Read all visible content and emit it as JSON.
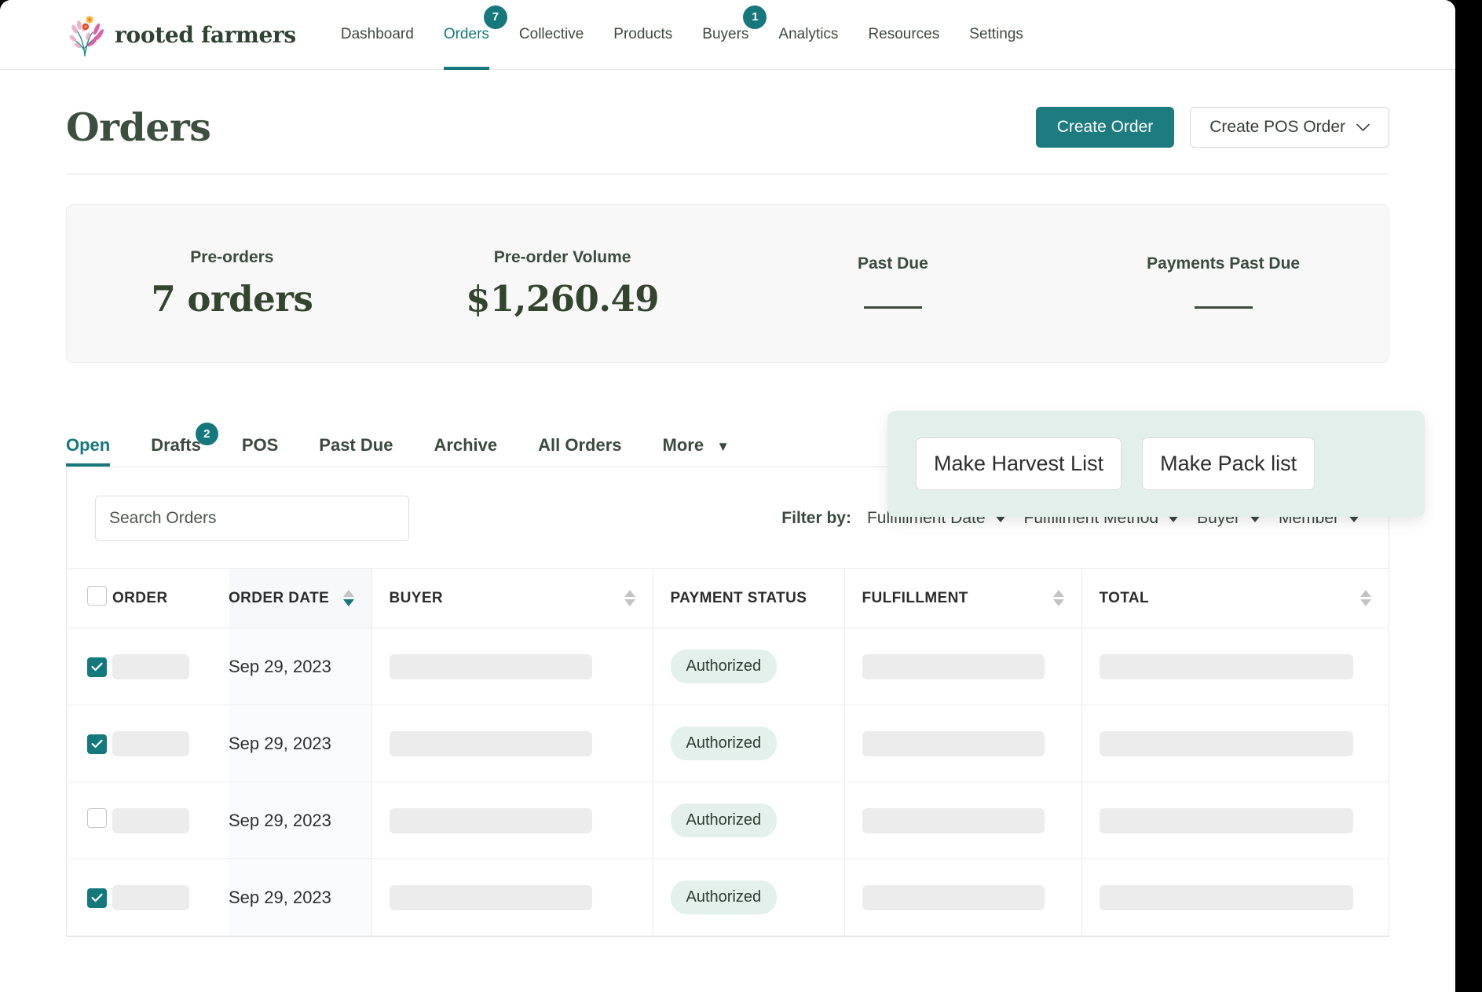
{
  "brand": {
    "name": "rooted farmers",
    "logo_icon": "floral-bouquet-icon"
  },
  "nav": {
    "items": [
      {
        "label": "Dashboard",
        "badge": null,
        "active": false
      },
      {
        "label": "Orders",
        "badge": "7",
        "active": true
      },
      {
        "label": "Collective",
        "badge": null,
        "active": false
      },
      {
        "label": "Products",
        "badge": null,
        "active": false
      },
      {
        "label": "Buyers",
        "badge": "1",
        "active": false
      },
      {
        "label": "Analytics",
        "badge": null,
        "active": false
      },
      {
        "label": "Resources",
        "badge": null,
        "active": false
      },
      {
        "label": "Settings",
        "badge": null,
        "active": false
      }
    ]
  },
  "page": {
    "title": "Orders",
    "create_order_label": "Create Order",
    "create_pos_order_label": "Create POS Order",
    "chevron_icon": "chevron-down-icon"
  },
  "stats": [
    {
      "label": "Pre-orders",
      "value": "7 orders",
      "empty": false
    },
    {
      "label": "Pre-order Volume",
      "value": "$1,260.49",
      "empty": false
    },
    {
      "label": "Past Due",
      "value": "",
      "empty": true
    },
    {
      "label": "Payments Past Due",
      "value": "",
      "empty": true
    }
  ],
  "tabs": [
    {
      "label": "Open",
      "badge": null,
      "active": true,
      "caret": false
    },
    {
      "label": "Drafts",
      "badge": "2",
      "active": false,
      "caret": false
    },
    {
      "label": "POS",
      "badge": null,
      "active": false,
      "caret": false
    },
    {
      "label": "Past Due",
      "badge": null,
      "active": false,
      "caret": false
    },
    {
      "label": "Archive",
      "badge": null,
      "active": false,
      "caret": false
    },
    {
      "label": "All Orders",
      "badge": null,
      "active": false,
      "caret": false
    },
    {
      "label": "More",
      "badge": null,
      "active": false,
      "caret": true,
      "caret_glyph": "▼"
    }
  ],
  "popover": {
    "harvest_list_label": "Make Harvest List",
    "pack_list_label": "Make Pack list",
    "background_color": "#e2efea"
  },
  "search": {
    "placeholder": "Search Orders",
    "value": ""
  },
  "filters": {
    "label": "Filter by:",
    "items": [
      {
        "label": "Fullfillment Date",
        "icon": "caret-down-icon"
      },
      {
        "label": "Fulfillment Method",
        "icon": "caret-down-icon"
      },
      {
        "label": "Buyer",
        "icon": "caret-down-icon"
      },
      {
        "label": "Member",
        "icon": "caret-down-icon"
      }
    ]
  },
  "table": {
    "headers": {
      "order": "ORDER",
      "order_date": "ORDER DATE",
      "buyer": "BUYER",
      "payment_status": "PAYMENT STATUS",
      "fulfillment": "FULFILLMENT",
      "total": "TOTAL"
    },
    "sort": {
      "column": "order_date",
      "direction": "desc"
    },
    "rows": [
      {
        "selected": true,
        "order": "",
        "order_date": "Sep 29, 2023",
        "buyer": "",
        "payment_status": "Authorized",
        "fulfillment": "",
        "total": ""
      },
      {
        "selected": true,
        "order": "",
        "order_date": "Sep 29, 2023",
        "buyer": "",
        "payment_status": "Authorized",
        "fulfillment": "",
        "total": ""
      },
      {
        "selected": false,
        "order": "",
        "order_date": "Sep 29, 2023",
        "buyer": "",
        "payment_status": "Authorized",
        "fulfillment": "",
        "total": ""
      },
      {
        "selected": true,
        "order": "",
        "order_date": "Sep 29, 2023",
        "buyer": "",
        "payment_status": "Authorized",
        "fulfillment": "",
        "total": ""
      }
    ]
  },
  "colors": {
    "accent_teal": "#16787c",
    "dark_green": "#3c4f3f",
    "badge_mint": "#e3f0ec",
    "panel_gray": "#f7f8f7"
  }
}
